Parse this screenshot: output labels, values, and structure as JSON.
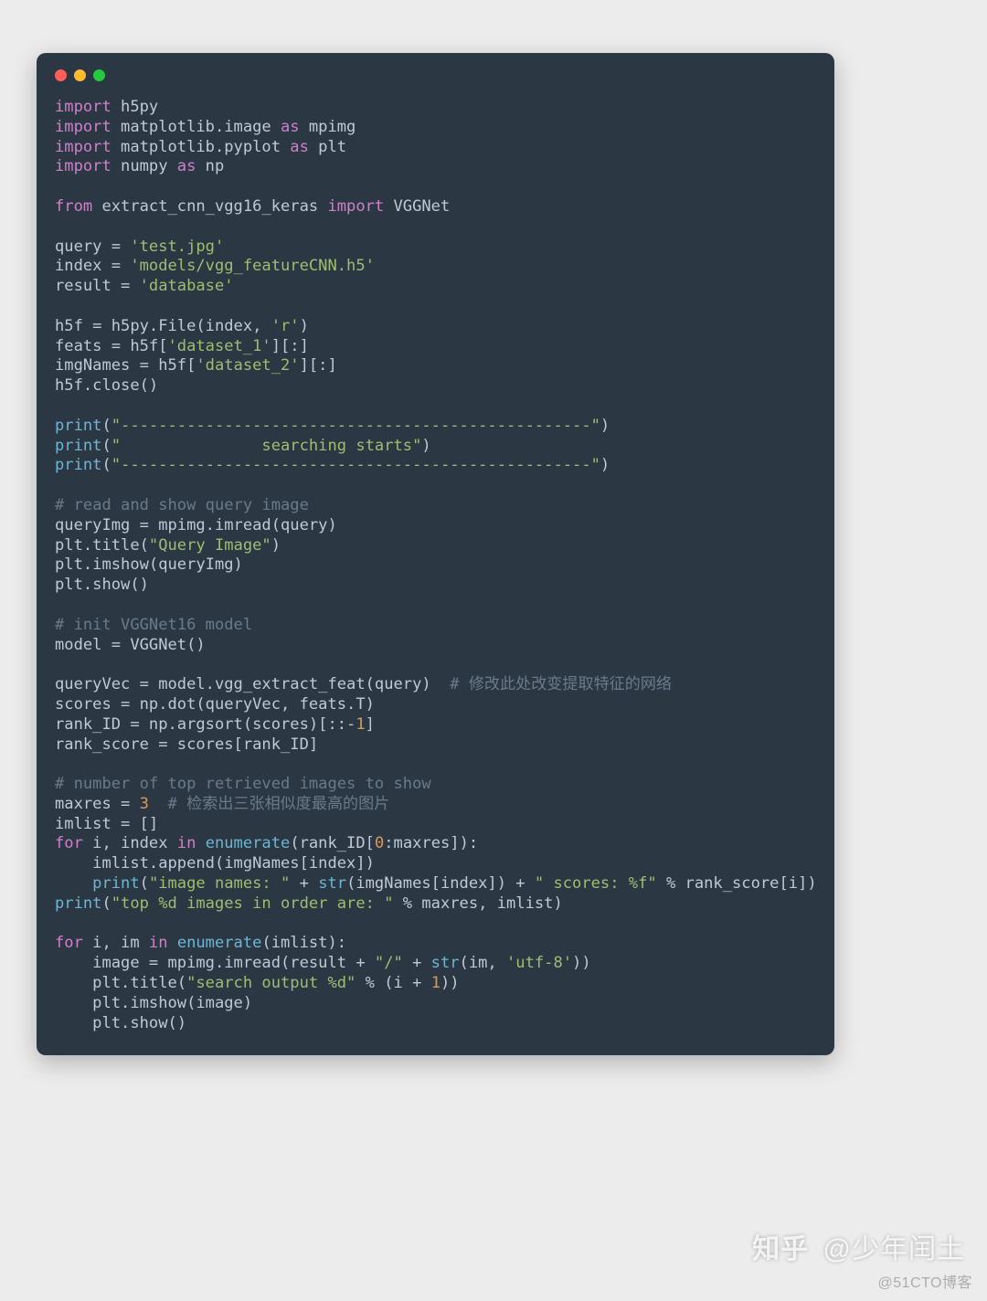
{
  "window": {
    "traffic_colors": {
      "red": "#ff5f56",
      "yellow": "#ffbd2e",
      "green": "#27c93f"
    }
  },
  "watermarks": {
    "zhihu_logo": "知乎",
    "zhihu_user": "@少年闰土",
    "cto": "@51CTO博客"
  },
  "code_tokens": [
    [
      [
        "kw",
        "import"
      ],
      [
        "def",
        " h5py"
      ]
    ],
    [
      [
        "kw",
        "import"
      ],
      [
        "def",
        " matplotlib.image "
      ],
      [
        "kw",
        "as"
      ],
      [
        "def",
        " mpimg"
      ]
    ],
    [
      [
        "kw",
        "import"
      ],
      [
        "def",
        " matplotlib.pyplot "
      ],
      [
        "kw",
        "as"
      ],
      [
        "def",
        " plt"
      ]
    ],
    [
      [
        "kw",
        "import"
      ],
      [
        "def",
        " numpy "
      ],
      [
        "kw",
        "as"
      ],
      [
        "def",
        " np"
      ]
    ],
    [],
    [
      [
        "kw",
        "from"
      ],
      [
        "def",
        " extract_cnn_vgg16_keras "
      ],
      [
        "kw",
        "import"
      ],
      [
        "def",
        " VGGNet"
      ]
    ],
    [],
    [
      [
        "def",
        "query = "
      ],
      [
        "str",
        "'test.jpg'"
      ]
    ],
    [
      [
        "def",
        "index = "
      ],
      [
        "str",
        "'models/vgg_featureCNN.h5'"
      ]
    ],
    [
      [
        "def",
        "result = "
      ],
      [
        "str",
        "'database'"
      ]
    ],
    [],
    [
      [
        "def",
        "h5f = h5py.File(index, "
      ],
      [
        "str",
        "'r'"
      ],
      [
        "def",
        ")"
      ]
    ],
    [
      [
        "def",
        "feats = h5f["
      ],
      [
        "str",
        "'dataset_1'"
      ],
      [
        "def",
        "][:]"
      ]
    ],
    [
      [
        "def",
        "imgNames = h5f["
      ],
      [
        "str",
        "'dataset_2'"
      ],
      [
        "def",
        "][:]"
      ]
    ],
    [
      [
        "def",
        "h5f.close()"
      ]
    ],
    [],
    [
      [
        "fn",
        "print"
      ],
      [
        "def",
        "("
      ],
      [
        "str",
        "\"--------------------------------------------------\""
      ],
      [
        "def",
        ")"
      ]
    ],
    [
      [
        "fn",
        "print"
      ],
      [
        "def",
        "("
      ],
      [
        "str",
        "\"               searching starts\""
      ],
      [
        "def",
        ")"
      ]
    ],
    [
      [
        "fn",
        "print"
      ],
      [
        "def",
        "("
      ],
      [
        "str",
        "\"--------------------------------------------------\""
      ],
      [
        "def",
        ")"
      ]
    ],
    [],
    [
      [
        "com",
        "# read and show query image"
      ]
    ],
    [
      [
        "def",
        "queryImg = mpimg.imread(query)"
      ]
    ],
    [
      [
        "def",
        "plt.title("
      ],
      [
        "str",
        "\"Query Image\""
      ],
      [
        "def",
        ")"
      ]
    ],
    [
      [
        "def",
        "plt.imshow(queryImg)"
      ]
    ],
    [
      [
        "def",
        "plt.show()"
      ]
    ],
    [],
    [
      [
        "com",
        "# init VGGNet16 model"
      ]
    ],
    [
      [
        "def",
        "model = VGGNet()"
      ]
    ],
    [],
    [
      [
        "def",
        "queryVec = model.vgg_extract_feat(query)  "
      ],
      [
        "com",
        "# 修改此处改变提取特征的网络"
      ]
    ],
    [
      [
        "def",
        "scores = np.dot(queryVec, feats.T)"
      ]
    ],
    [
      [
        "def",
        "rank_ID = np.argsort(scores)[::-"
      ],
      [
        "num",
        "1"
      ],
      [
        "def",
        "]"
      ]
    ],
    [
      [
        "def",
        "rank_score = scores[rank_ID]"
      ]
    ],
    [],
    [
      [
        "com",
        "# number of top retrieved images to show"
      ]
    ],
    [
      [
        "def",
        "maxres = "
      ],
      [
        "num",
        "3"
      ],
      [
        "def",
        "  "
      ],
      [
        "com",
        "# 检索出三张相似度最高的图片"
      ]
    ],
    [
      [
        "def",
        "imlist = []"
      ]
    ],
    [
      [
        "kw",
        "for"
      ],
      [
        "def",
        " i, index "
      ],
      [
        "kw",
        "in"
      ],
      [
        "def",
        " "
      ],
      [
        "fn",
        "enumerate"
      ],
      [
        "def",
        "(rank_ID["
      ],
      [
        "num",
        "0"
      ],
      [
        "def",
        ":maxres]):"
      ]
    ],
    [
      [
        "def",
        "    imlist.append(imgNames[index])"
      ]
    ],
    [
      [
        "def",
        "    "
      ],
      [
        "fn",
        "print"
      ],
      [
        "def",
        "("
      ],
      [
        "str",
        "\"image names: \""
      ],
      [
        "def",
        " + "
      ],
      [
        "fn",
        "str"
      ],
      [
        "def",
        "(imgNames[index]) + "
      ],
      [
        "str",
        "\" scores: %f\""
      ],
      [
        "def",
        " % rank_score[i])"
      ]
    ],
    [
      [
        "fn",
        "print"
      ],
      [
        "def",
        "("
      ],
      [
        "str",
        "\"top %d images in order are: \""
      ],
      [
        "def",
        " % maxres, imlist)"
      ]
    ],
    [],
    [
      [
        "kw",
        "for"
      ],
      [
        "def",
        " i, im "
      ],
      [
        "kw",
        "in"
      ],
      [
        "def",
        " "
      ],
      [
        "fn",
        "enumerate"
      ],
      [
        "def",
        "(imlist):"
      ]
    ],
    [
      [
        "def",
        "    image = mpimg.imread(result + "
      ],
      [
        "str",
        "\"/\""
      ],
      [
        "def",
        " + "
      ],
      [
        "fn",
        "str"
      ],
      [
        "def",
        "(im, "
      ],
      [
        "str",
        "'utf-8'"
      ],
      [
        "def",
        "))"
      ]
    ],
    [
      [
        "def",
        "    plt.title("
      ],
      [
        "str",
        "\"search output %d\""
      ],
      [
        "def",
        " % (i + "
      ],
      [
        "num",
        "1"
      ],
      [
        "def",
        "))"
      ]
    ],
    [
      [
        "def",
        "    plt.imshow(image)"
      ]
    ],
    [
      [
        "def",
        "    plt.show()"
      ]
    ]
  ]
}
